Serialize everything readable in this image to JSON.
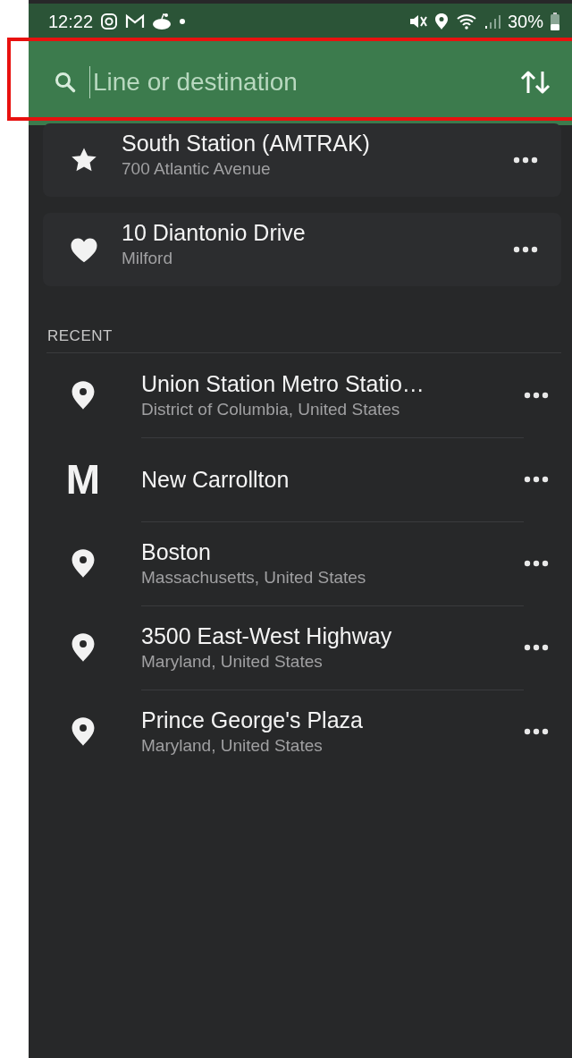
{
  "status_bar": {
    "time": "12:22",
    "battery": "30%"
  },
  "search": {
    "placeholder": "Line or destination"
  },
  "favorites": [
    {
      "kind": "star",
      "title": "South Station (AMTRAK)",
      "subtitle": "700 Atlantic Avenue"
    },
    {
      "kind": "heart",
      "title": "10 Diantonio Drive",
      "subtitle": "Milford"
    }
  ],
  "recent_header": "RECENT",
  "recent": [
    {
      "kind": "pin",
      "title": "Union Station Metro Statio…",
      "subtitle": "District of Columbia, United States"
    },
    {
      "kind": "metro",
      "badge": "M",
      "title": "New Carrollton"
    },
    {
      "kind": "pin",
      "title": "Boston",
      "subtitle": "Massachusetts, United States"
    },
    {
      "kind": "pin",
      "title": "3500 East-West Highway",
      "subtitle": "Maryland, United States"
    },
    {
      "kind": "pin",
      "title": "Prince George's Plaza",
      "subtitle": "Maryland, United States"
    }
  ]
}
